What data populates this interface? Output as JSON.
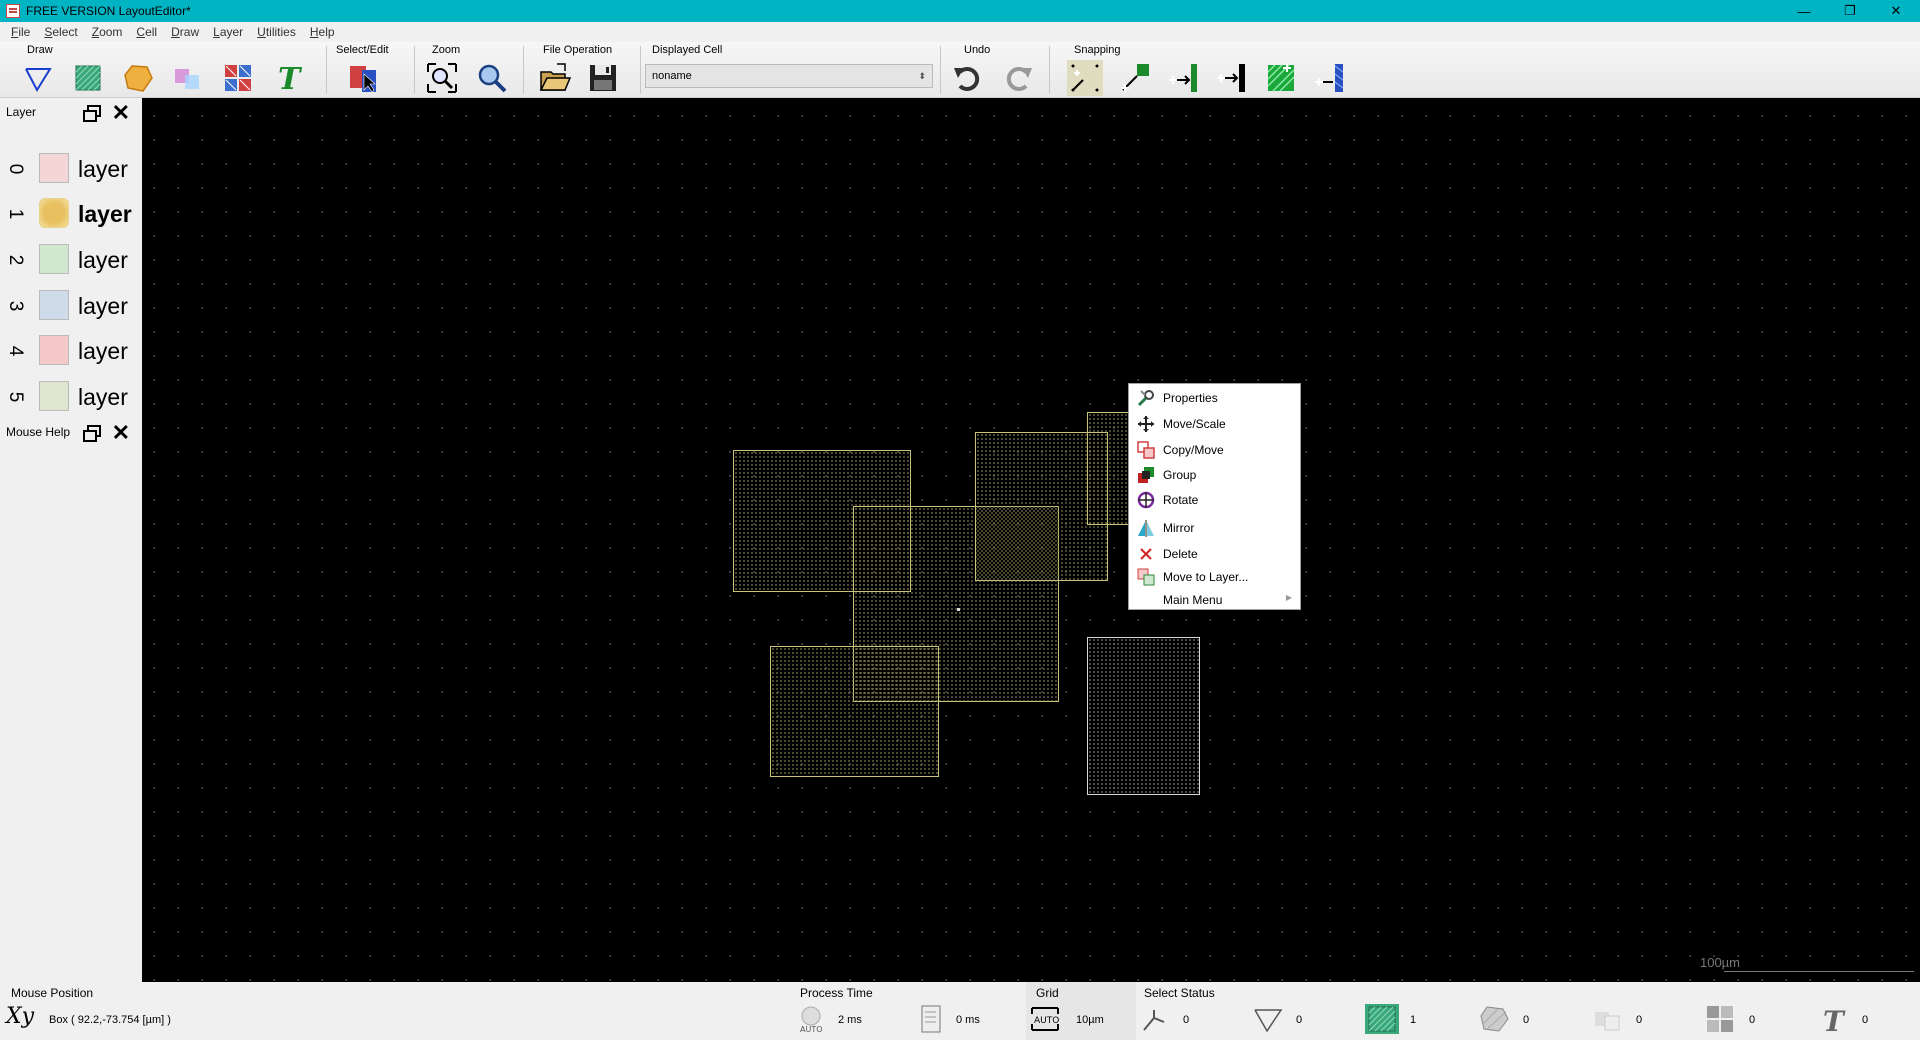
{
  "window": {
    "title": "FREE VERSION LayoutEditor*",
    "controls": [
      "—",
      "❐",
      "✕"
    ]
  },
  "menu": [
    "File",
    "Select",
    "Zoom",
    "Cell",
    "Draw",
    "Layer",
    "Utilities",
    "Help"
  ],
  "toolbar": {
    "groups": {
      "draw": "Draw",
      "select_edit": "Select/Edit",
      "zoom": "Zoom",
      "file_operation": "File Operation",
      "displayed_cell": "Displayed Cell",
      "undo": "Undo",
      "snapping": "Snapping"
    },
    "displayed_cell_value": "noname",
    "colors": {
      "accent": "#00b4c4"
    }
  },
  "layer_panel": {
    "title": "Layer",
    "layers": [
      {
        "num": "0",
        "name": "layer",
        "color": "#f4d6d6",
        "active": false
      },
      {
        "num": "1",
        "name": "layer",
        "color": "#e8c060",
        "active": true
      },
      {
        "num": "2",
        "name": "layer",
        "color": "#cfe8cf",
        "active": false
      },
      {
        "num": "3",
        "name": "layer",
        "color": "#cfdbe8",
        "active": false
      },
      {
        "num": "4",
        "name": "layer",
        "color": "#f4c8c8",
        "active": false
      },
      {
        "num": "5",
        "name": "layer",
        "color": "#dfe6cf",
        "active": false
      }
    ]
  },
  "mouse_help_panel": {
    "title": "Mouse Help"
  },
  "canvas": {
    "scale_label": "100µm"
  },
  "context_menu": {
    "items": [
      {
        "label": "Properties",
        "icon": "properties-icon"
      },
      {
        "label": "Move/Scale",
        "icon": "move-icon"
      },
      {
        "label": "Copy/Move",
        "icon": "copy-icon"
      },
      {
        "label": "Group",
        "icon": "group-icon"
      },
      {
        "label": "Rotate",
        "icon": "rotate-icon"
      },
      {
        "label": "Mirror",
        "icon": "mirror-icon"
      },
      {
        "label": "Delete",
        "icon": "delete-icon"
      },
      {
        "label": "Move to Layer...",
        "icon": "move-to-layer-icon"
      },
      {
        "label": "Main Menu",
        "icon": "",
        "submenu": true
      }
    ]
  },
  "status": {
    "mouse_position_label": "Mouse Position",
    "xy_glyph": "Xy",
    "mouse_position_value": "Box   ( 92.2,-73.754 [µm] )",
    "process_time_label": "Process Time",
    "process_time_1": "2 ms",
    "process_time_2": "0 ms",
    "grid_label": "Grid",
    "grid_value": "10µm",
    "auto_text": "AUTO",
    "select_status_label": "Select Status",
    "select_counts": [
      "0",
      "0",
      "1",
      "0",
      "0",
      "0",
      "0"
    ]
  }
}
